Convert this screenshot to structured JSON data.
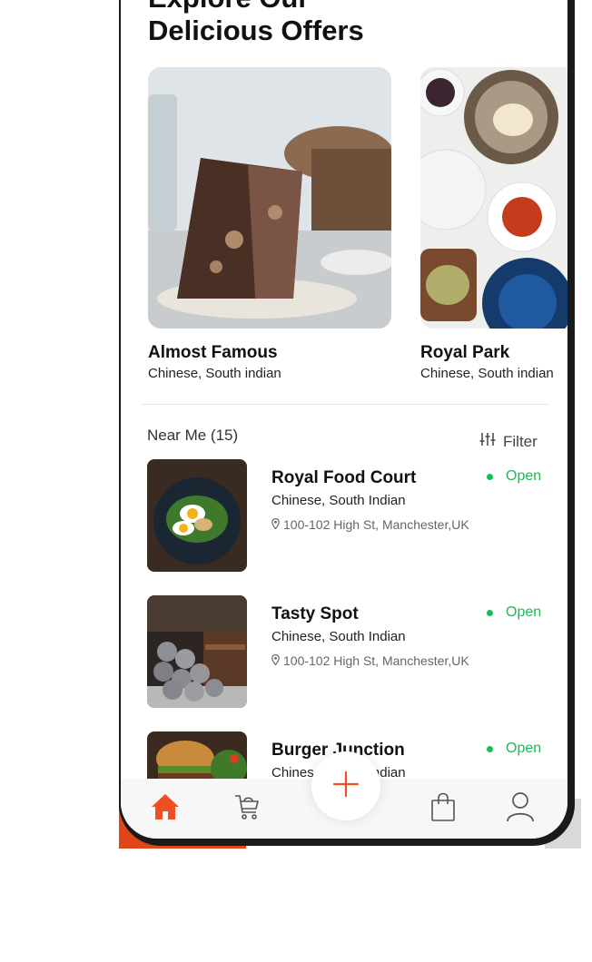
{
  "header": {
    "title_line1": "Explore Our",
    "title_line2": "Delicious Offers"
  },
  "offers": [
    {
      "name": "Almost Famous",
      "cuisine": "Chinese, South indian"
    },
    {
      "name": "Royal Park",
      "cuisine": "Chinese, South indian"
    }
  ],
  "nearby": {
    "heading": "Near Me (15)",
    "filter_label": "Filter",
    "restaurants": [
      {
        "name": "Royal Food Court",
        "cuisine": "Chinese, South Indian",
        "address": "100-102 High St, Manchester,UK",
        "status": "Open"
      },
      {
        "name": "Tasty Spot",
        "cuisine": "Chinese, South Indian",
        "address": "100-102 High St, Manchester,UK",
        "status": "Open"
      },
      {
        "name": "Burger Junction",
        "cuisine": "Chinese, South Indian",
        "address": "",
        "status": "Open"
      }
    ]
  },
  "nav": {
    "icons": [
      "home-icon",
      "cart-icon",
      "add-icon",
      "bag-icon",
      "profile-icon"
    ],
    "active_color": "#f04e23"
  },
  "colors": {
    "accent": "#f04e23",
    "open_status": "#1db954"
  }
}
